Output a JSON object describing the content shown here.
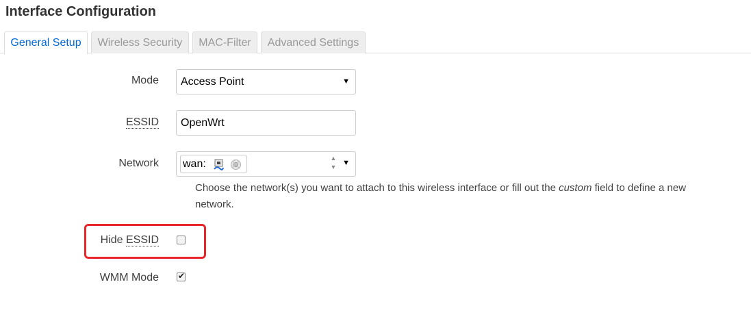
{
  "page_title": "Interface Configuration",
  "tabs": [
    {
      "label": "General Setup",
      "active": true
    },
    {
      "label": "Wireless Security",
      "active": false
    },
    {
      "label": "MAC-Filter",
      "active": false
    },
    {
      "label": "Advanced Settings",
      "active": false
    }
  ],
  "form": {
    "mode": {
      "label": "Mode",
      "value": "Access Point"
    },
    "essid": {
      "label": "ESSID",
      "value": "OpenWrt"
    },
    "network": {
      "label": "Network",
      "chip_label": "wan:",
      "icons": [
        "ethernet-port-icon",
        "wifi-network-icon"
      ],
      "help_before": "Choose the network(s) you want to attach to this wireless interface or fill out the ",
      "help_em": "custom",
      "help_after": " field to define a new",
      "help_line2": "network."
    },
    "hide_essid": {
      "label_prefix": "Hide ",
      "label_abbr": "ESSID",
      "checked": false
    },
    "wmm_mode": {
      "label": "WMM Mode",
      "checked": true
    }
  },
  "colors": {
    "active_tab": "#0069d6",
    "highlight_border": "#e8262a"
  }
}
